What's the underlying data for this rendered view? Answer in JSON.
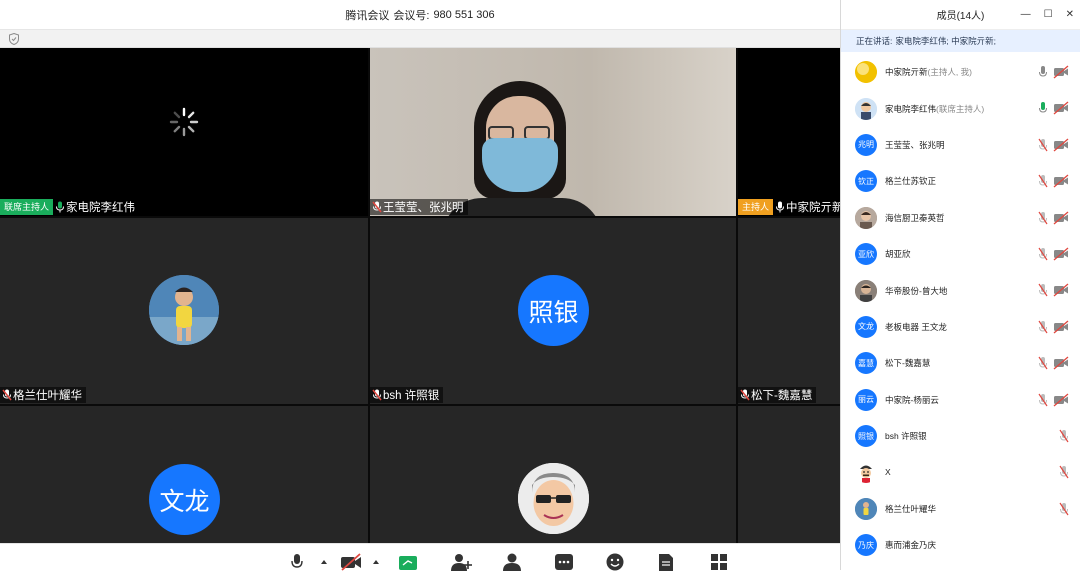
{
  "app": {
    "name": "腾讯会议",
    "meeting_label": "会议号:",
    "meeting_id": "980 551 306"
  },
  "tiles": [
    {
      "name": "家电院李红伟",
      "role": "联席主持人",
      "role_color": "#1aad5c",
      "mic": "on",
      "kind": "loading"
    },
    {
      "name": "王莹莹、张兆明",
      "role": "",
      "mic": "muted",
      "kind": "camera"
    },
    {
      "name": "中家院亓新",
      "role": "主持人",
      "role_color": "#f0a020",
      "mic": "on",
      "kind": "black"
    },
    {
      "name": "格兰仕叶耀华",
      "role": "",
      "mic": "muted",
      "kind": "photo-avatar"
    },
    {
      "name": "bsh 许照银",
      "role": "",
      "mic": "muted",
      "kind": "text-avatar",
      "avatar_text": "照银"
    },
    {
      "name": "松下-魏嘉慧",
      "role": "",
      "mic": "muted",
      "kind": "empty"
    },
    {
      "name": "",
      "role": "",
      "kind": "text-avatar",
      "avatar_text": "文龙"
    },
    {
      "name": "",
      "role": "",
      "kind": "cartoon-avatar"
    },
    {
      "name": "",
      "role": "",
      "kind": "empty"
    }
  ],
  "panel": {
    "title": "成员(14人)",
    "speaking_label": "正在讲话:",
    "speaking_names": "家电院李红伟; 中家院亓新;",
    "members": [
      {
        "name": "中家院亓新",
        "role": "(主持人, 我)",
        "avatar": "moon",
        "mic": "on",
        "video": "off"
      },
      {
        "name": "家电院李红伟",
        "role": "(联席主持人)",
        "avatar": "cartoon",
        "mic": "active",
        "video": "off"
      },
      {
        "name": "王莹莹、张兆明",
        "role": "",
        "avatar_text": "兆明",
        "mic": "muted",
        "video": "off"
      },
      {
        "name": "格兰仕苏钦正",
        "role": "",
        "avatar_text": "钦正",
        "mic": "muted",
        "video": "off"
      },
      {
        "name": "海信厨卫秦英哲",
        "role": "",
        "avatar": "photo",
        "mic": "muted",
        "video": "off"
      },
      {
        "name": "胡亚欣",
        "role": "",
        "avatar_text": "亚欣",
        "mic": "muted",
        "video": "off"
      },
      {
        "name": "华帝股份-曾大地",
        "role": "",
        "avatar": "photo2",
        "mic": "muted",
        "video": "off"
      },
      {
        "name": "老板电器 王文龙",
        "role": "",
        "avatar_text": "文龙",
        "mic": "muted",
        "video": "off"
      },
      {
        "name": "松下-魏嘉慧",
        "role": "",
        "avatar_text": "嘉慧",
        "mic": "muted",
        "video": "off"
      },
      {
        "name": "中家院-杨丽云",
        "role": "",
        "avatar_text": "丽云",
        "mic": "muted",
        "video": "off"
      },
      {
        "name": "bsh 许照银",
        "role": "",
        "avatar_text": "照银",
        "mic": "muted",
        "video": "none"
      },
      {
        "name": "X",
        "role": "",
        "avatar": "mario",
        "mic": "muted",
        "video": "none"
      },
      {
        "name": "格兰仕叶耀华",
        "role": "",
        "avatar": "photo3",
        "mic": "muted",
        "video": "none"
      },
      {
        "name": "惠而浦金乃庆",
        "role": "",
        "avatar_text": "乃庆",
        "mic": "none",
        "video": "none"
      }
    ]
  },
  "colors": {
    "accent_blue": "#1677ff",
    "cohost_green": "#1aad5c",
    "host_orange": "#f0a020",
    "muted_red": "#e0473f"
  }
}
